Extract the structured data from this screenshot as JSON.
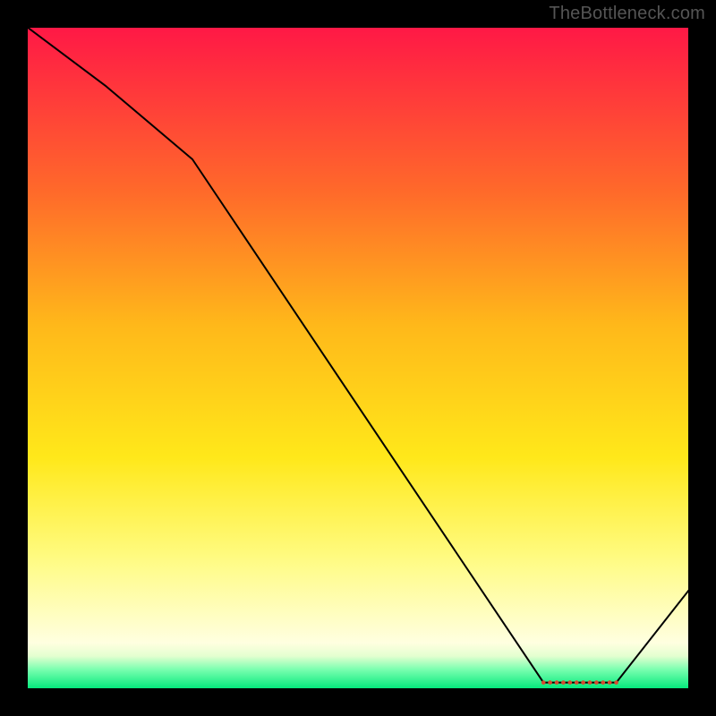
{
  "watermark": "TheBottleneck.com",
  "chart_data": {
    "type": "line",
    "title": "",
    "xlabel": "",
    "ylabel": "",
    "xlim": [
      0,
      100
    ],
    "ylim": [
      0,
      100
    ],
    "grid": false,
    "legend": false,
    "background_gradient": {
      "description": "vertical gradient over plot interior, top-to-bottom",
      "stops": [
        {
          "pos": 0.0,
          "color": "#ff1846"
        },
        {
          "pos": 0.25,
          "color": "#ff6a2a"
        },
        {
          "pos": 0.45,
          "color": "#ffb81a"
        },
        {
          "pos": 0.65,
          "color": "#ffe81a"
        },
        {
          "pos": 0.8,
          "color": "#fffb80"
        },
        {
          "pos": 0.93,
          "color": "#ffffe0"
        },
        {
          "pos": 0.95,
          "color": "#e4ffd0"
        },
        {
          "pos": 0.97,
          "color": "#7bffb0"
        },
        {
          "pos": 1.0,
          "color": "#00e87a"
        }
      ]
    },
    "series": [
      {
        "name": "value-curve",
        "color": "#000000",
        "width": 2,
        "x": [
          0,
          25,
          78,
          89,
          100
        ],
        "y": [
          100,
          80,
          1,
          1,
          15
        ],
        "note": "y reads as percentage of vertical range; curve reaches near-zero trough ~x=78–89 then rises"
      }
    ],
    "markers": {
      "name": "trough-markers",
      "type": "scatter",
      "color": "#d94a2e",
      "radius": 2.3,
      "x": [
        78,
        79,
        80,
        81,
        82,
        83,
        84,
        85,
        86,
        87,
        88,
        89
      ],
      "y": [
        1,
        1,
        1,
        1,
        1,
        1,
        1,
        1,
        1,
        1,
        1,
        1
      ]
    }
  }
}
